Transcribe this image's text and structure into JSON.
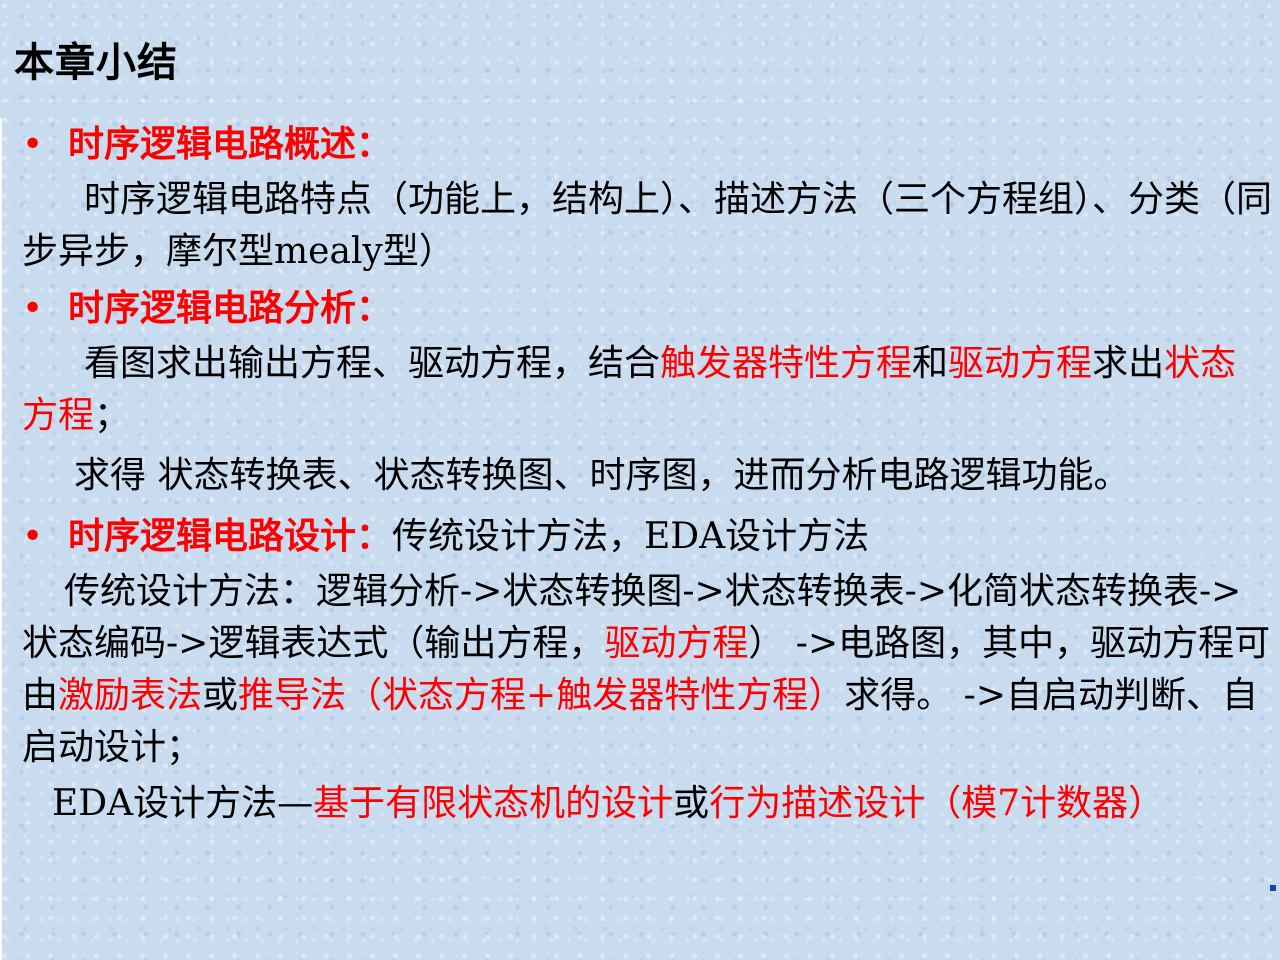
{
  "title": "本章小结",
  "bullet_symbol": "•",
  "section1": {
    "heading": "时序逻辑电路概述：",
    "text": "时序逻辑电路特点（功能上，结构上）、描述方法（三个方程组）、分类（同步异步，摩尔型mealy型）"
  },
  "section2": {
    "heading": "时序逻辑电路分析：",
    "p1_a": "看图求出输出方程、驱动方程，结合",
    "p1_b": "触发器特性方程",
    "p1_c": "和",
    "p1_d": "驱动方程",
    "p1_e": "求出",
    "p1_f": "状态方程",
    "p1_g": "；",
    "p2": "求得 状态转换表、状态转换图、时序图，进而分析电路逻辑功能。"
  },
  "section3": {
    "heading": "时序逻辑电路设计：",
    "heading_tail": "传统设计方法，EDA设计方法",
    "p1_a": "传统设计方法：逻辑分析->状态转换图->状态转换表->化简状态转换表->状态编码->逻辑表达式（输出方程，",
    "p1_b": "驱动方程",
    "p1_c": "） ->电路图，其中，驱动方程可由",
    "p1_d": "激励表法",
    "p1_e": "或",
    "p1_f": "推导法（状态方程+触发器特性方程）",
    "p1_g": "求得。 ->自启动判断、自启动设计；",
    "p2_a": "EDA设计方法—",
    "p2_b": "基于有限状态机的设计",
    "p2_c": "或",
    "p2_d": "行为描述设计（模7计数器）"
  }
}
